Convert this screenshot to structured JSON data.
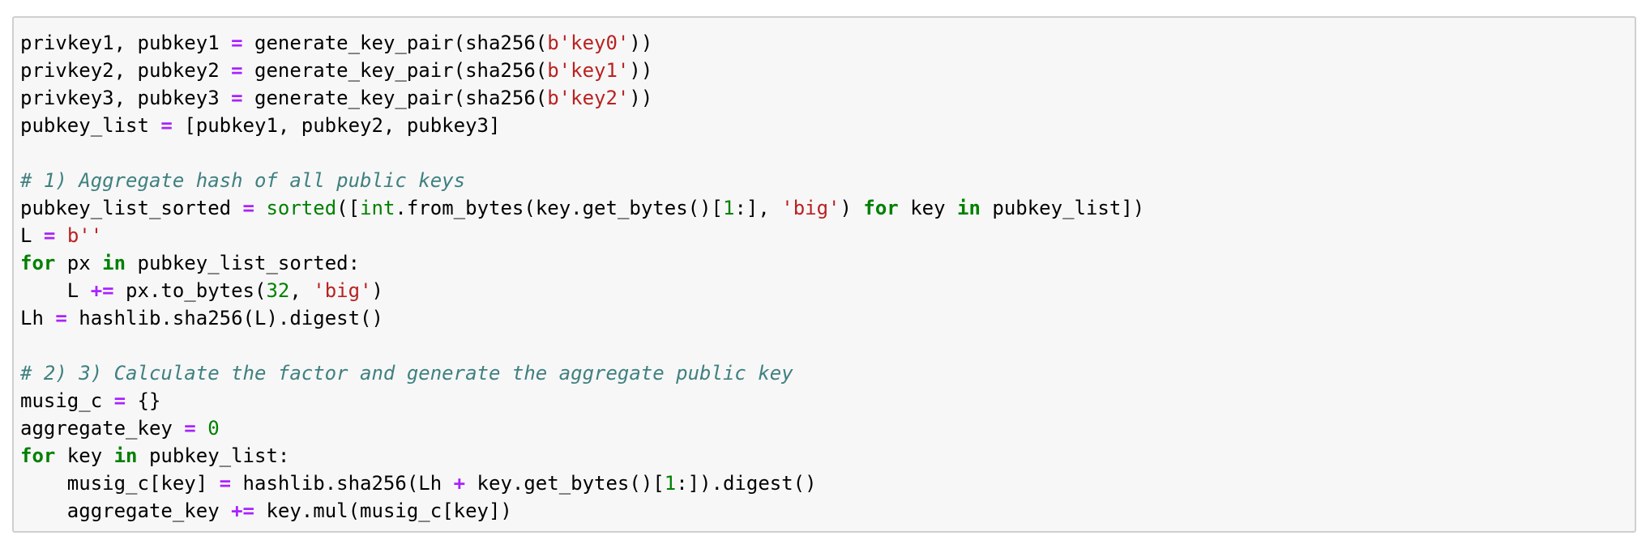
{
  "colors": {
    "operator": "#aa22ff",
    "string": "#ba2121",
    "number": "#008000",
    "keyword": "#008000",
    "builtin": "#008000",
    "comment": "#408080",
    "text": "#000000",
    "cell_background": "#f7f7f7",
    "cell_border": "#cfcfcf"
  },
  "code_cell": {
    "lines": [
      [
        {
          "t": "privkey1, pubkey1 ",
          "c": "n"
        },
        {
          "t": "=",
          "c": "op"
        },
        {
          "t": " generate_key_pair(sha256(",
          "c": "n"
        },
        {
          "t": "b'key0'",
          "c": "str"
        },
        {
          "t": "))",
          "c": "n"
        }
      ],
      [
        {
          "t": "privkey2, pubkey2 ",
          "c": "n"
        },
        {
          "t": "=",
          "c": "op"
        },
        {
          "t": " generate_key_pair(sha256(",
          "c": "n"
        },
        {
          "t": "b'key1'",
          "c": "str"
        },
        {
          "t": "))",
          "c": "n"
        }
      ],
      [
        {
          "t": "privkey3, pubkey3 ",
          "c": "n"
        },
        {
          "t": "=",
          "c": "op"
        },
        {
          "t": " generate_key_pair(sha256(",
          "c": "n"
        },
        {
          "t": "b'key2'",
          "c": "str"
        },
        {
          "t": "))",
          "c": "n"
        }
      ],
      [
        {
          "t": "pubkey_list ",
          "c": "n"
        },
        {
          "t": "=",
          "c": "op"
        },
        {
          "t": " [pubkey1, pubkey2, pubkey3]",
          "c": "n"
        }
      ],
      [],
      [
        {
          "t": "# 1) Aggregate hash of all public keys",
          "c": "com"
        }
      ],
      [
        {
          "t": "pubkey_list_sorted ",
          "c": "n"
        },
        {
          "t": "=",
          "c": "op"
        },
        {
          "t": " ",
          "c": "n"
        },
        {
          "t": "sorted",
          "c": "bi"
        },
        {
          "t": "([",
          "c": "n"
        },
        {
          "t": "int",
          "c": "bi"
        },
        {
          "t": ".from_bytes(key.get_bytes()[",
          "c": "n"
        },
        {
          "t": "1",
          "c": "num"
        },
        {
          "t": ":], ",
          "c": "n"
        },
        {
          "t": "'big'",
          "c": "str"
        },
        {
          "t": ") ",
          "c": "n"
        },
        {
          "t": "for",
          "c": "kw"
        },
        {
          "t": " key ",
          "c": "n"
        },
        {
          "t": "in",
          "c": "kw"
        },
        {
          "t": " pubkey_list])",
          "c": "n"
        }
      ],
      [
        {
          "t": "L ",
          "c": "n"
        },
        {
          "t": "=",
          "c": "op"
        },
        {
          "t": " ",
          "c": "n"
        },
        {
          "t": "b''",
          "c": "str"
        }
      ],
      [
        {
          "t": "for",
          "c": "kw"
        },
        {
          "t": " px ",
          "c": "n"
        },
        {
          "t": "in",
          "c": "kw"
        },
        {
          "t": " pubkey_list_sorted:",
          "c": "n"
        }
      ],
      [
        {
          "t": "    L ",
          "c": "n"
        },
        {
          "t": "+=",
          "c": "op"
        },
        {
          "t": " px.to_bytes(",
          "c": "n"
        },
        {
          "t": "32",
          "c": "num"
        },
        {
          "t": ", ",
          "c": "n"
        },
        {
          "t": "'big'",
          "c": "str"
        },
        {
          "t": ")",
          "c": "n"
        }
      ],
      [
        {
          "t": "Lh ",
          "c": "n"
        },
        {
          "t": "=",
          "c": "op"
        },
        {
          "t": " hashlib.sha256(L).digest()",
          "c": "n"
        }
      ],
      [],
      [
        {
          "t": "# 2) 3) Calculate the factor and generate the aggregate public key",
          "c": "com"
        }
      ],
      [
        {
          "t": "musig_c ",
          "c": "n"
        },
        {
          "t": "=",
          "c": "op"
        },
        {
          "t": " {}",
          "c": "n"
        }
      ],
      [
        {
          "t": "aggregate_key ",
          "c": "n"
        },
        {
          "t": "=",
          "c": "op"
        },
        {
          "t": " ",
          "c": "n"
        },
        {
          "t": "0",
          "c": "num"
        }
      ],
      [
        {
          "t": "for",
          "c": "kw"
        },
        {
          "t": " key ",
          "c": "n"
        },
        {
          "t": "in",
          "c": "kw"
        },
        {
          "t": " pubkey_list:",
          "c": "n"
        }
      ],
      [
        {
          "t": "    musig_c[key] ",
          "c": "n"
        },
        {
          "t": "=",
          "c": "op"
        },
        {
          "t": " hashlib.sha256(Lh ",
          "c": "n"
        },
        {
          "t": "+",
          "c": "op"
        },
        {
          "t": " key.get_bytes()[",
          "c": "n"
        },
        {
          "t": "1",
          "c": "num"
        },
        {
          "t": ":]).digest()",
          "c": "n"
        }
      ],
      [
        {
          "t": "    aggregate_key ",
          "c": "n"
        },
        {
          "t": "+=",
          "c": "op"
        },
        {
          "t": " key.mul(musig_c[key])",
          "c": "n"
        }
      ]
    ]
  }
}
